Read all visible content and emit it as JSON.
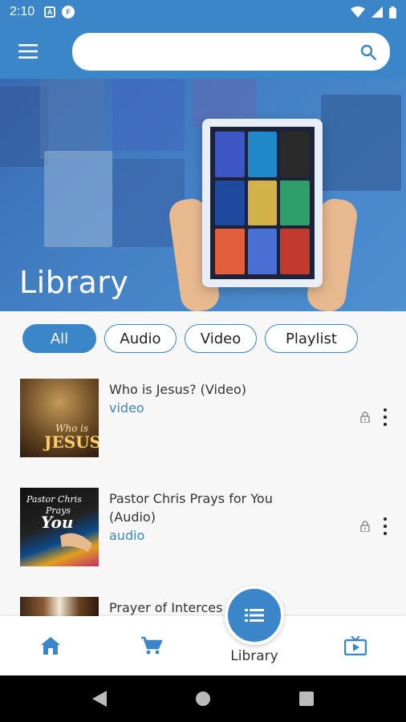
{
  "status_bar": {
    "time": "2:10",
    "icons": [
      "notification-a-icon",
      "flipboard-icon",
      "wifi-icon",
      "signal-icon",
      "battery-icon"
    ]
  },
  "app_bar": {
    "menu_icon": "hamburger-menu-icon",
    "search": {
      "placeholder": "",
      "value": "",
      "icon": "search-icon"
    }
  },
  "hero": {
    "title": "Library"
  },
  "filters": {
    "chips": [
      {
        "label": "All",
        "active": true
      },
      {
        "label": "Audio",
        "active": false
      },
      {
        "label": "Video",
        "active": false
      },
      {
        "label": "Playlist",
        "active": false
      }
    ]
  },
  "items": [
    {
      "title": "Who is Jesus? (Video)",
      "type": "video",
      "thumb_text": "Who is JESUS?"
    },
    {
      "title": "Pastor Chris Prays for You (Audio)",
      "type": "audio",
      "thumb_text": "Pastor Chris Prays for You"
    },
    {
      "title": "Prayer of Interces",
      "type": "",
      "thumb_text": ""
    }
  ],
  "bottom_nav": {
    "home_icon": "home-icon",
    "cart_icon": "cart-icon",
    "library_label": "Library",
    "library_icon": "list-icon",
    "tv_icon": "tv-icon"
  },
  "system_nav": [
    "back-icon",
    "home-circle-icon",
    "recents-icon"
  ],
  "colors": {
    "primary": "#3a86c8",
    "background": "#f7f7f7",
    "text": "#333333"
  }
}
